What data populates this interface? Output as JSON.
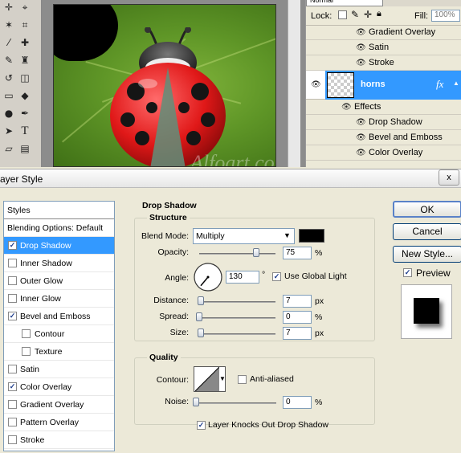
{
  "workspace": {
    "layers_panel": {
      "blend_mode": "Normal",
      "lock_label": "Lock:",
      "fill_label": "Fill:",
      "fill_value": "100%",
      "rows": [
        {
          "name": "Gradient Overlay"
        },
        {
          "name": "Satin"
        },
        {
          "name": "Stroke"
        }
      ],
      "active_layer": {
        "name": "horns",
        "fx": "fx"
      },
      "effects_label": "Effects",
      "effects": [
        {
          "name": "Drop Shadow"
        },
        {
          "name": "Bevel and Emboss"
        },
        {
          "name": "Color Overlay"
        }
      ]
    },
    "watermark": "Alfoart.com"
  },
  "dialog": {
    "title": "ayer Style",
    "close_label": "x",
    "styles_header": "Styles",
    "styles": [
      {
        "label": "Blending Options: Default",
        "checkbox": false,
        "checked": false,
        "selected": false,
        "sub": false
      },
      {
        "label": "Drop Shadow",
        "checkbox": true,
        "checked": true,
        "selected": true,
        "sub": false
      },
      {
        "label": "Inner Shadow",
        "checkbox": true,
        "checked": false,
        "selected": false,
        "sub": false
      },
      {
        "label": "Outer Glow",
        "checkbox": true,
        "checked": false,
        "selected": false,
        "sub": false
      },
      {
        "label": "Inner Glow",
        "checkbox": true,
        "checked": false,
        "selected": false,
        "sub": false
      },
      {
        "label": "Bevel and Emboss",
        "checkbox": true,
        "checked": true,
        "selected": false,
        "sub": false
      },
      {
        "label": "Contour",
        "checkbox": true,
        "checked": false,
        "selected": false,
        "sub": true
      },
      {
        "label": "Texture",
        "checkbox": true,
        "checked": false,
        "selected": false,
        "sub": true
      },
      {
        "label": "Satin",
        "checkbox": true,
        "checked": false,
        "selected": false,
        "sub": false
      },
      {
        "label": "Color Overlay",
        "checkbox": true,
        "checked": true,
        "selected": false,
        "sub": false
      },
      {
        "label": "Gradient Overlay",
        "checkbox": true,
        "checked": false,
        "selected": false,
        "sub": false
      },
      {
        "label": "Pattern Overlay",
        "checkbox": true,
        "checked": false,
        "selected": false,
        "sub": false
      },
      {
        "label": "Stroke",
        "checkbox": true,
        "checked": false,
        "selected": false,
        "sub": false
      }
    ],
    "section_title": "Drop Shadow",
    "structure": {
      "title": "Structure",
      "blend_mode_label": "Blend Mode:",
      "blend_mode_value": "Multiply",
      "shadow_color": "#000000",
      "opacity_label": "Opacity:",
      "opacity_value": "75",
      "opacity_unit": "%",
      "opacity_level": 0.75,
      "angle_label": "Angle:",
      "angle_value": "130",
      "angle_unit": "°",
      "use_global_light_label": "Use Global Light",
      "use_global_light": true,
      "distance_label": "Distance:",
      "distance_value": "7",
      "distance_unit": "px",
      "distance_level": 0.02,
      "spread_label": "Spread:",
      "spread_value": "0",
      "spread_unit": "%",
      "spread_level": 0,
      "size_label": "Size:",
      "size_value": "7",
      "size_unit": "px",
      "size_level": 0.02
    },
    "quality": {
      "title": "Quality",
      "contour_label": "Contour:",
      "anti_aliased_label": "Anti-aliased",
      "anti_aliased": false,
      "noise_label": "Noise:",
      "noise_value": "0",
      "noise_unit": "%",
      "noise_level": 0,
      "knockout_label": "Layer Knocks Out Drop Shadow",
      "knockout": true
    },
    "buttons": {
      "ok": "OK",
      "cancel": "Cancel",
      "new_style": "New Style...",
      "preview_label": "Preview",
      "preview": true
    }
  }
}
